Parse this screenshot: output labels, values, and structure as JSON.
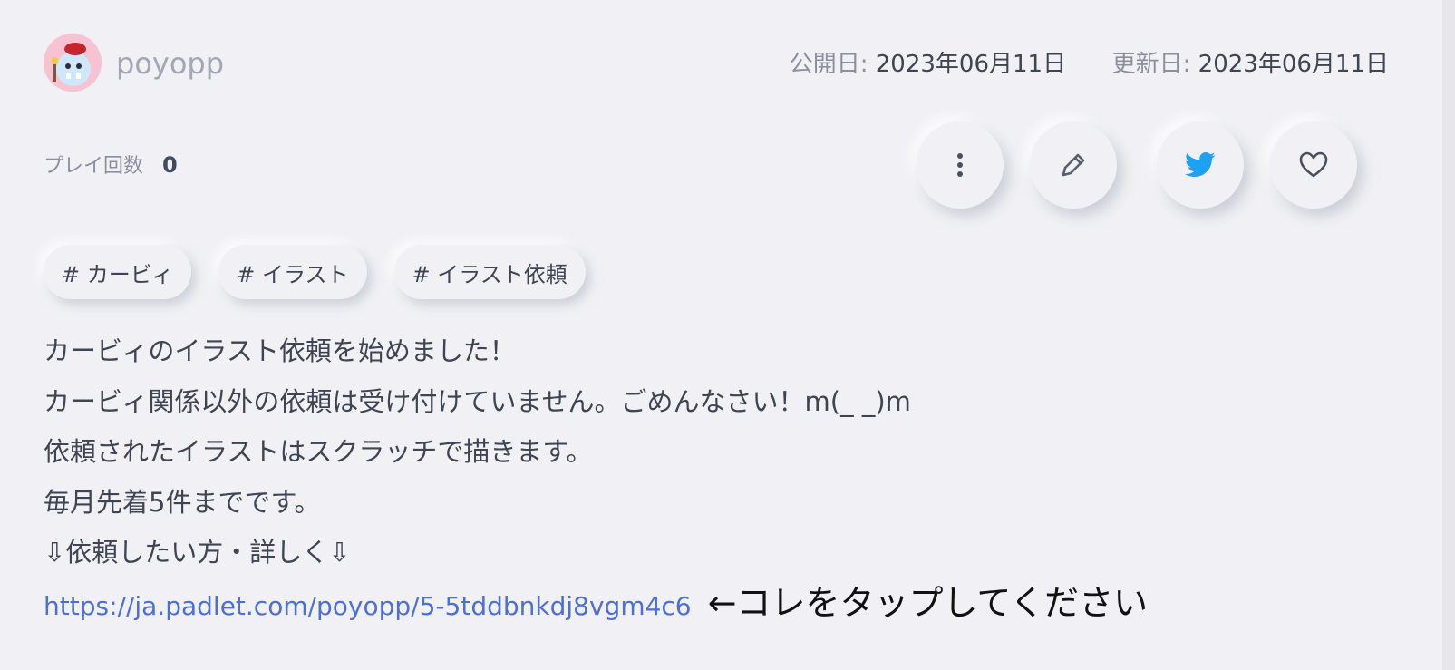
{
  "author": {
    "username": "poyopp"
  },
  "dates": {
    "published_label": "公開日:",
    "published_value": "2023年06月11日",
    "updated_label": "更新日:",
    "updated_value": "2023年06月11日"
  },
  "stats": {
    "play_count_label": "プレイ回数",
    "play_count_value": "0"
  },
  "actions": {
    "icons": [
      "more-vertical-icon",
      "pencil-icon",
      "twitter-icon",
      "heart-icon"
    ],
    "twitter_color": "#1da1f2"
  },
  "tags": [
    "# カービィ",
    "# イラスト",
    "# イラスト依頼"
  ],
  "description": {
    "lines": [
      "カービィのイラスト依頼を始めました！",
      "カービィ関係以外の依頼は受け付けていません。ごめんなさい！m(_ _)m",
      "依頼されたイラストはスクラッチで描きます。",
      "毎月先着5件までです。",
      "⇩依頼したい方・詳しく⇩"
    ],
    "link": "https://ja.padlet.com/poyopp/5-5tddbnkdj8vgm4c6",
    "link_hint": "←コレをタップしてください"
  },
  "colors": {
    "background": "#f1f1f5",
    "link": "#4e6fd6",
    "text": "#3f4452",
    "muted": "#8b8f9d"
  }
}
